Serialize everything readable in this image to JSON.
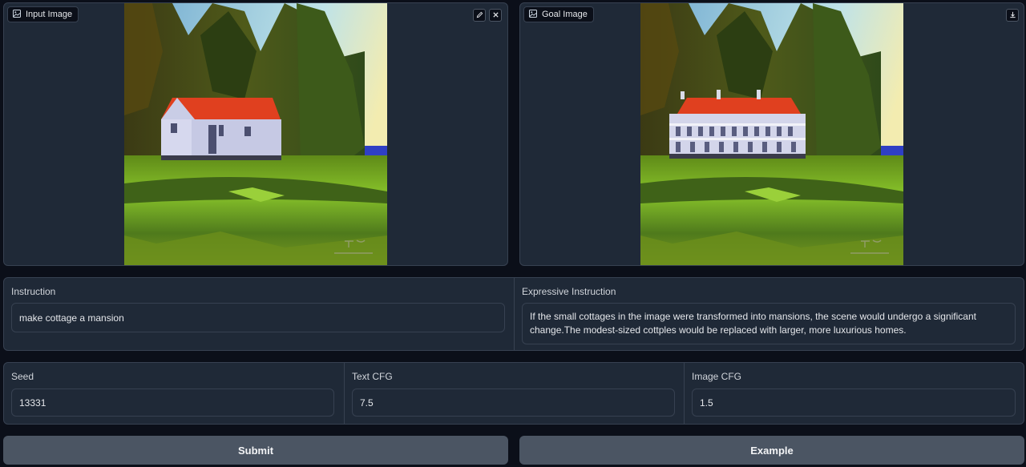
{
  "input_image": {
    "label": "Input Image",
    "icon": "image-icon",
    "actions": [
      "edit-icon",
      "close-icon"
    ]
  },
  "goal_image": {
    "label": "Goal Image",
    "icon": "image-icon",
    "actions": [
      "download-icon"
    ]
  },
  "instruction": {
    "label": "Instruction",
    "value": "make cottage a mansion"
  },
  "expressive_instruction": {
    "label": "Expressive Instruction",
    "value": "If the small cottages in the image were transformed into mansions, the scene would undergo a significant change.The modest-sized cottples would be replaced with larger, more luxurious homes."
  },
  "seed": {
    "label": "Seed",
    "value": "13331"
  },
  "text_cfg": {
    "label": "Text CFG",
    "value": "7.5"
  },
  "image_cfg": {
    "label": "Image CFG",
    "value": "1.5"
  },
  "buttons": {
    "submit": "Submit",
    "example": "Example"
  },
  "colors": {
    "background": "#0b0f19",
    "panel": "#1f2937",
    "border": "#374151",
    "button": "#4b5563",
    "roof": "#e0401f",
    "sea": "#2f3fc4",
    "grass": "#86c22a"
  }
}
